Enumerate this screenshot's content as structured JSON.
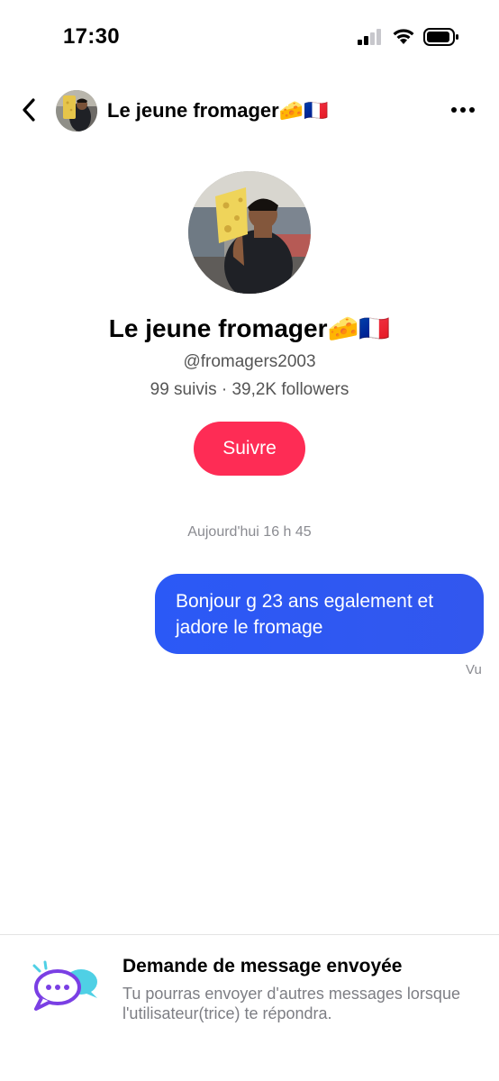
{
  "status_bar": {
    "time": "17:30"
  },
  "header": {
    "title": "Le jeune fromager🧀🇫🇷",
    "back_icon": "chevron-left-icon",
    "more_icon": "ellipsis-icon"
  },
  "profile": {
    "name": "Le jeune fromager🧀🇫🇷",
    "handle": "@fromagers2003",
    "stats": "99 suivis · 39,2K followers",
    "follow_label": "Suivre"
  },
  "conversation": {
    "timestamp": "Aujourd'hui 16 h 45",
    "messages": [
      {
        "text": "Bonjour g 23 ans egalement et jadore le fromage",
        "sent": true
      }
    ],
    "seen_label": "Vu"
  },
  "notice": {
    "title": "Demande de message envoyée",
    "body": "Tu pourras envoyer d'autres messages lorsque l'utilisateur(trice) te répondra."
  },
  "colors": {
    "follow_button": "#fe2c55",
    "bubble": "#2b59f6",
    "muted_text": "#8a8b91"
  }
}
